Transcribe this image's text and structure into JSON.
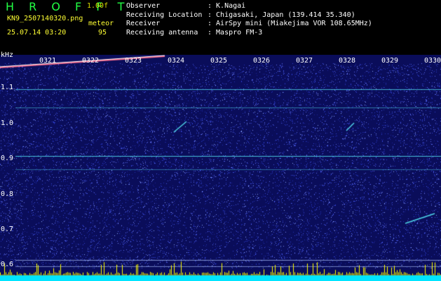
{
  "header": {
    "app_title": "H R O F F T",
    "version": "1.00f",
    "filename": "KN9_2507140320.png",
    "meteor_label": "meteor",
    "datetime": "25.07.14 03:20",
    "count": "95"
  },
  "meta": [
    {
      "key": "Observer",
      "value": ": K.Nagai"
    },
    {
      "key": "Receiving Location",
      "value": ": Chigasaki, Japan (139.414 35.340)"
    },
    {
      "key": "Receiver",
      "value": ": AirSpy mini (Miakejima VOR 108.65MHz)"
    },
    {
      "key": "Receiving antenna",
      "value": ": Maspro FM-3"
    }
  ],
  "plot": {
    "unit": "kHz",
    "y_ticks": [
      "1.1",
      "1.0",
      "0.9",
      "0.8",
      "0.7",
      "0.6"
    ],
    "x_ticks": [
      "0321",
      "0322",
      "0323",
      "0324",
      "0325",
      "0326",
      "0327",
      "0328",
      "0329",
      "0330"
    ],
    "colors": {
      "background": "#0a0d5a",
      "noise": "#2a35c8",
      "signal": "#4fd6e8",
      "bottom_bar": "#00e5ff",
      "spike": "#ffff00"
    }
  }
}
